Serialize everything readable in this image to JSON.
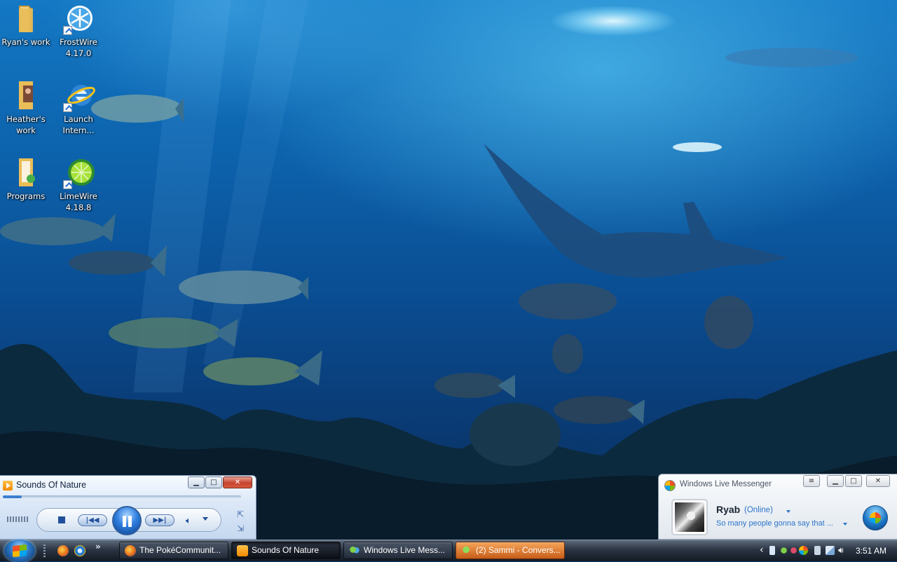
{
  "desktop": {
    "icons": [
      {
        "label": "Ryan's work"
      },
      {
        "label": "FrostWire\n4.17.0"
      },
      {
        "label": "Heather's\nwork"
      },
      {
        "label": "Launch\nIntern..."
      },
      {
        "label": "Programs"
      },
      {
        "label": "LimeWire\n4.18.8"
      }
    ]
  },
  "media_player": {
    "title": "Sounds Of Nature",
    "progress": 0.08,
    "controls": {
      "stop": "stop-icon",
      "previous": "previous-icon",
      "play_pause": "pause-icon",
      "next": "next-icon",
      "volume": "speaker-icon"
    }
  },
  "messenger": {
    "title": "Windows Live Messenger",
    "user_name": "Ryab",
    "status": "(Online)",
    "personal_message": "So many people gonna say that ..."
  },
  "taskbar": {
    "more_label": "»",
    "buttons": [
      {
        "label": "The PokéCommunit..."
      },
      {
        "label": "Sounds Of Nature"
      },
      {
        "label": "Windows Live Mess..."
      },
      {
        "label": "(2) Sammi - Convers..."
      }
    ],
    "tray_expand": "‹",
    "clock": "3:51 AM"
  },
  "colors": {
    "accent_blue": "#2c73c9",
    "flash_orange": "#e37a2f",
    "taskbar_dark": "#1b2330"
  }
}
